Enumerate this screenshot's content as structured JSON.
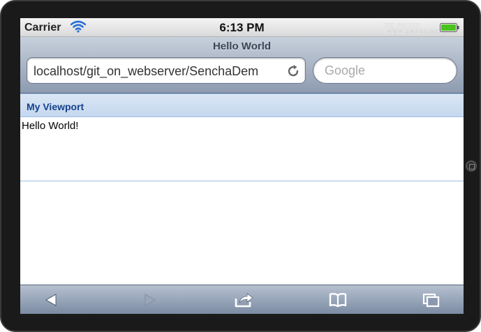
{
  "status_bar": {
    "carrier": "Carrier",
    "time": "6:13 PM",
    "watermark": "西部网",
    "watermark_sub": "WWW.CWEST.NET",
    "wifi_icon": "wifi-icon",
    "battery_icon": "battery-icon"
  },
  "browser": {
    "page_title": "Hello World",
    "url": "localhost/git_on_webserver/SenchaDem",
    "search_placeholder": "Google",
    "reload_icon": "reload-icon"
  },
  "page": {
    "panel_title": "My Viewport",
    "panel_body": "Hello World!"
  },
  "toolbar": {
    "icons": [
      "back-arrow-icon",
      "forward-arrow-icon",
      "share-icon",
      "bookmarks-icon",
      "tabs-icon"
    ]
  },
  "colors": {
    "panel_title": "#15428b",
    "panel_border": "#99bbe8",
    "chrome_top": "#c7d0dc",
    "chrome_bottom": "#8d9bb0"
  }
}
